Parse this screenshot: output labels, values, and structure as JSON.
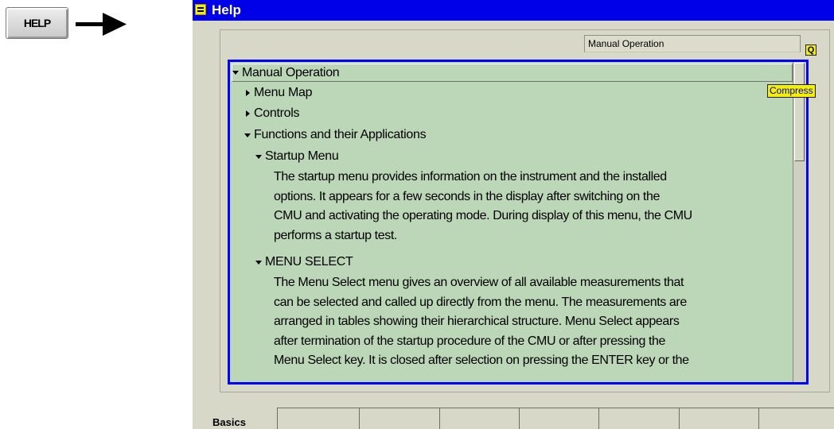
{
  "key": {
    "label": "HELP"
  },
  "window": {
    "title": "Help"
  },
  "path_label": "Manual Operation",
  "badges": {
    "q": "Q",
    "compress": "Compress"
  },
  "tree": {
    "root": "Manual Operation",
    "menu_map": "Menu Map",
    "controls": "Controls",
    "functions": "Functions and their Applications",
    "startup_menu": {
      "title": "Startup Menu",
      "lines": [
        "The startup menu provides information on the instrument and the installed",
        "options. It appears for a few seconds in the display after switching on the",
        "CMU and activating the operating mode. During display of this menu, the CMU",
        "performs a startup test."
      ]
    },
    "menu_select": {
      "title": "MENU SELECT",
      "lines": [
        "The Menu Select menu gives an overview of all available measurements that",
        "can be selected and called up directly from the menu. The measurements are",
        "arranged in tables showing their hierarchical structure. Menu Select appears",
        "after termination of the startup procedure of the CMU or after pressing the",
        "Menu Select key. It is closed after selection on pressing the ENTER key or the"
      ]
    }
  },
  "softkeys": [
    "Basics",
    "",
    "",
    "",
    "",
    "",
    "",
    ""
  ]
}
